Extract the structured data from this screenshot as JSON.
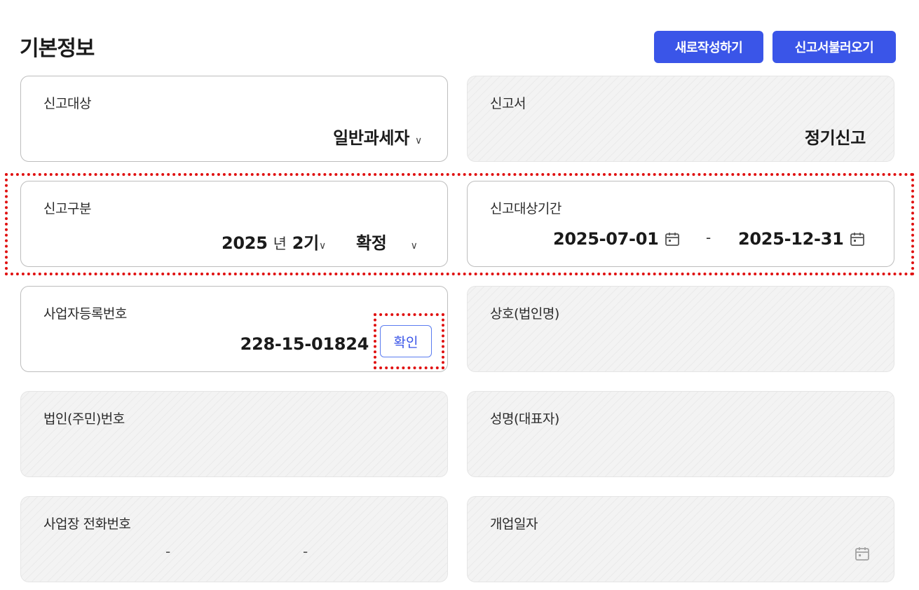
{
  "header": {
    "title": "기본정보",
    "new_button": "새로작성하기",
    "load_button": "신고서불러오기"
  },
  "fields": {
    "target": {
      "label": "신고대상",
      "value": "일반과세자"
    },
    "report": {
      "label": "신고서",
      "value": "정기신고"
    },
    "category": {
      "label": "신고구분",
      "year": "2025",
      "year_unit": "년",
      "term": "2기",
      "type": "확정"
    },
    "period": {
      "label": "신고대상기간",
      "start": "2025-07-01",
      "separator": "-",
      "end": "2025-12-31"
    },
    "biz_reg_no": {
      "label": "사업자등록번호",
      "value": "228-15-01824",
      "confirm_button": "확인"
    },
    "company_name": {
      "label": "상호(법인명)",
      "value": ""
    },
    "corp_id": {
      "label": "법인(주민)번호",
      "value": ""
    },
    "rep_name": {
      "label": "성명(대표자)",
      "value": ""
    },
    "phone": {
      "label": "사업장 전화번호",
      "separator1": "-",
      "separator2": "-"
    },
    "open_date": {
      "label": "개업일자",
      "value": ""
    }
  },
  "colors": {
    "primary": "#3a55e8",
    "highlight": "#e01010",
    "readonly_bg": "#f3f3f3"
  },
  "icons": {
    "dropdown": "chevron-down-icon",
    "date": "calendar-icon"
  }
}
